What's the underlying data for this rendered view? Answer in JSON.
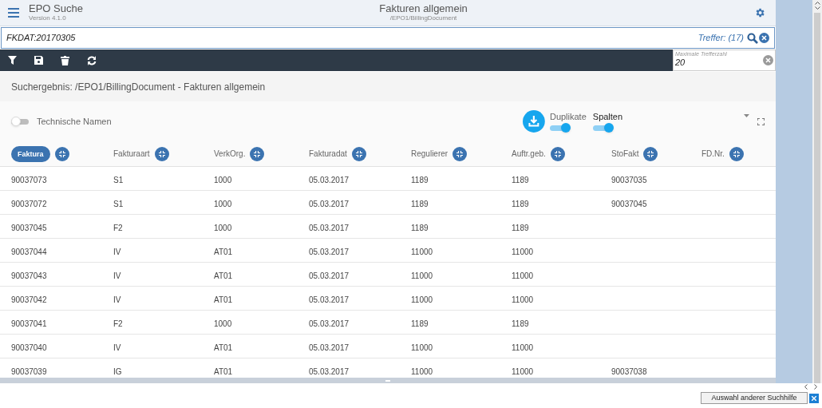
{
  "app": {
    "name": "EPO Suche",
    "version": "Version 4.1.0"
  },
  "header": {
    "title": "Fakturen allgemein",
    "subtitle": "/EPO1/BillingDocument"
  },
  "search": {
    "value": "FKDAT:20170305",
    "hits": "Treffer: (17)"
  },
  "max_hits": {
    "label": "Maximale Trefferzahl",
    "value": "20"
  },
  "result_title": "Suchergebnis: /EPO1/BillingDocument - Fakturen allgemein",
  "toggles": [
    {
      "label": "Technische Namen",
      "on": false
    },
    {
      "label": "Duplikate",
      "on": true
    },
    {
      "label": "Spalten",
      "on": true
    }
  ],
  "columns": [
    {
      "label": "Faktura",
      "selected": true
    },
    {
      "label": "Fakturaart",
      "selected": false
    },
    {
      "label": "VerkOrg.",
      "selected": false
    },
    {
      "label": "Fakturadat",
      "selected": false
    },
    {
      "label": "Regulierer",
      "selected": false
    },
    {
      "label": "Auftr.geb.",
      "selected": false
    },
    {
      "label": "StoFakt",
      "selected": false
    },
    {
      "label": "FD.Nr.",
      "selected": false
    }
  ],
  "rows": [
    [
      "90037073",
      "S1",
      "1000",
      "05.03.2017",
      "1189",
      "1189",
      "90037035",
      ""
    ],
    [
      "90037072",
      "S1",
      "1000",
      "05.03.2017",
      "1189",
      "1189",
      "90037045",
      ""
    ],
    [
      "90037045",
      "F2",
      "1000",
      "05.03.2017",
      "1189",
      "1189",
      "",
      ""
    ],
    [
      "90037044",
      "IV",
      "AT01",
      "05.03.2017",
      "11000",
      "11000",
      "",
      ""
    ],
    [
      "90037043",
      "IV",
      "AT01",
      "05.03.2017",
      "11000",
      "11000",
      "",
      ""
    ],
    [
      "90037042",
      "IV",
      "AT01",
      "05.03.2017",
      "11000",
      "11000",
      "",
      ""
    ],
    [
      "90037041",
      "F2",
      "1000",
      "05.03.2017",
      "1189",
      "1189",
      "",
      ""
    ],
    [
      "90037040",
      "IV",
      "AT01",
      "05.03.2017",
      "11000",
      "11000",
      "",
      ""
    ],
    [
      "90037039",
      "IG",
      "AT01",
      "05.03.2017",
      "11000",
      "11000",
      "90037038",
      ""
    ]
  ],
  "footer_button": "Auswahl anderer Suchhilfe"
}
